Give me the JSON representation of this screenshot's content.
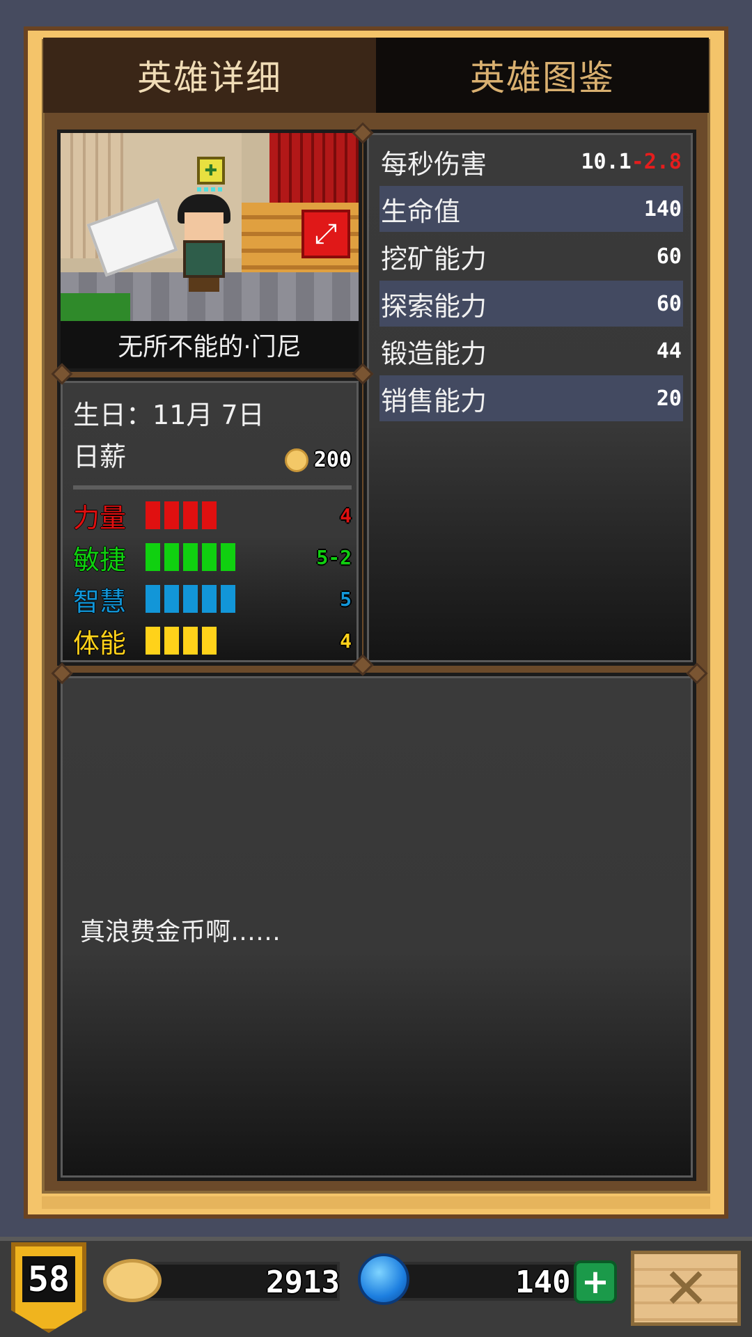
{
  "tabs": {
    "detail": "英雄详细",
    "codex": "英雄图鉴"
  },
  "hero": {
    "name": "无所不能的·门尼",
    "birthday_label": "生日：",
    "birthday_value": "11月 7日",
    "salary_label": "日薪",
    "salary_value": "200",
    "quote": "真浪费金币啊……"
  },
  "attributes": [
    {
      "label": "力量",
      "value": "4",
      "bars": 4,
      "color": "#e01010"
    },
    {
      "label": "敏捷",
      "value": "5-2",
      "bars": 5,
      "color": "#10d010"
    },
    {
      "label": "智慧",
      "value": "5",
      "bars": 5,
      "color": "#1296d8"
    },
    {
      "label": "体能",
      "value": "4",
      "bars": 4,
      "color": "#ffd21a"
    }
  ],
  "stats": [
    {
      "label": "每秒伤害",
      "value": "10.1",
      "modifier": "-2.8"
    },
    {
      "label": "生命值",
      "value": "140"
    },
    {
      "label": "挖矿能力",
      "value": "60"
    },
    {
      "label": "探索能力",
      "value": "60"
    },
    {
      "label": "锻造能力",
      "value": "44"
    },
    {
      "label": "销售能力",
      "value": "20"
    }
  ],
  "bottom": {
    "level": "58",
    "gold": "2913",
    "gems": "140"
  },
  "icons": {
    "expand": "expand-icon",
    "close": "close-icon",
    "plus": "plus-icon",
    "gold": "gold-coin-icon",
    "gem": "gem-icon"
  }
}
